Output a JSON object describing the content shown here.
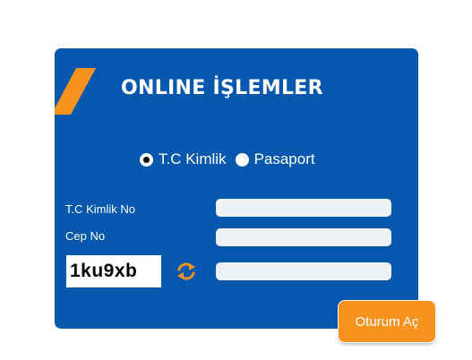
{
  "panel": {
    "title": "ONLINE İŞLEMLER",
    "background_color": "#0558ad",
    "accent_color": "#f7931e"
  },
  "id_type": {
    "options": [
      {
        "label": "T.C Kimlik",
        "selected": true
      },
      {
        "label": "Pasaport",
        "selected": false
      }
    ]
  },
  "form": {
    "tc_label": "T.C Kimlik No",
    "tc_value": "",
    "phone_label": "Cep No",
    "phone_value": "",
    "captcha_text": "1ku9xb",
    "captcha_input_value": "",
    "refresh_icon": "refresh-icon"
  },
  "actions": {
    "submit_label": "Oturum Aç"
  }
}
